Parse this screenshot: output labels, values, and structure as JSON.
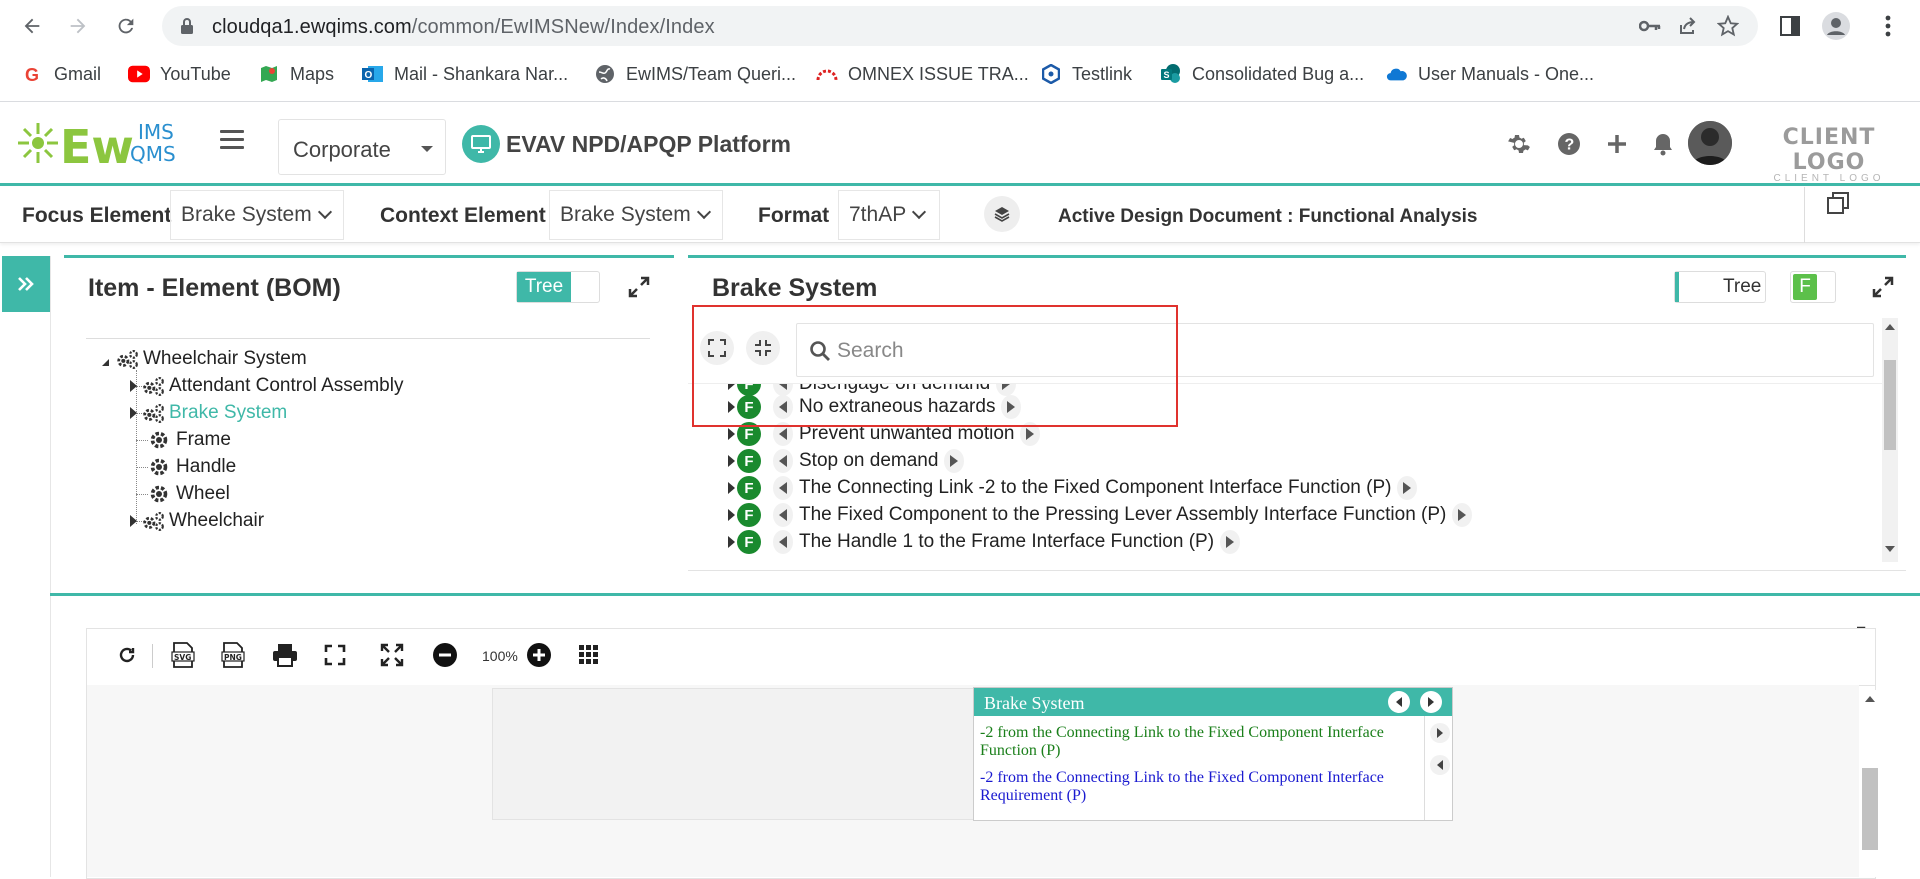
{
  "browser": {
    "url_host": "cloudqa1.ewqims.com",
    "url_path": "/common/EwIMSNew/Index/Index",
    "bookmarks": [
      {
        "label": "Gmail",
        "icon": "gmail-icon"
      },
      {
        "label": "YouTube",
        "icon": "youtube-icon"
      },
      {
        "label": "Maps",
        "icon": "maps-icon"
      },
      {
        "label": "Mail - Shankara Nar...",
        "icon": "outlook-icon"
      },
      {
        "label": "EwIMS/Team Queri...",
        "icon": "globe-icon"
      },
      {
        "label": "OMNEX ISSUE TRA...",
        "icon": "tracker-icon"
      },
      {
        "label": "Testlink",
        "icon": "testlink-icon"
      },
      {
        "label": "Consolidated Bug a...",
        "icon": "sharepoint-icon"
      },
      {
        "label": "User Manuals - One...",
        "icon": "onedrive-icon"
      }
    ]
  },
  "header": {
    "logo_text": "EwIMSQMS",
    "org_select": "Corporate",
    "platform_title": "EVAV NPD/APQP Platform",
    "client_logo": "CLIENT LOGO",
    "client_logo_sub": "CLIENT LOGO"
  },
  "focusbar": {
    "focus_label": "Focus Element",
    "focus_value": "Brake System",
    "context_label": "Context Element",
    "context_value": "Brake System",
    "format_label": "Format",
    "format_value": "7thAP",
    "active_doc": "Active Design Document : Functional Analysis"
  },
  "bom_panel": {
    "title": "Item - Element (BOM)",
    "toggle_label": "Tree",
    "tree": [
      {
        "label": "Wheelchair System",
        "level": 0,
        "expandable": true,
        "selected": false
      },
      {
        "label": "Attendant Control Assembly",
        "level": 1,
        "expandable": true,
        "selected": false
      },
      {
        "label": "Brake System",
        "level": 1,
        "expandable": true,
        "selected": true
      },
      {
        "label": "Frame",
        "level": 1,
        "expandable": false,
        "selected": false
      },
      {
        "label": "Handle",
        "level": 1,
        "expandable": false,
        "selected": false
      },
      {
        "label": "Wheel",
        "level": 1,
        "expandable": false,
        "selected": false
      },
      {
        "label": "Wheelchair",
        "level": 1,
        "expandable": true,
        "selected": false
      }
    ]
  },
  "function_panel": {
    "title": "Brake System",
    "toggle_label": "Tree",
    "f_badge": "F",
    "search_placeholder": "Search",
    "functions": [
      "Disengage on demand",
      "No extraneous hazards",
      "Prevent unwanted motion",
      "Stop on demand",
      "The Connecting Link -2 to the Fixed Component Interface Function (P)",
      "The Fixed Component to the Pressing Lever Assembly Interface Function (P)",
      "The Handle 1 to the Frame Interface Function (P)"
    ]
  },
  "diagram": {
    "zoom": "100%",
    "toolbar": [
      "refresh-icon",
      "svg-export-icon",
      "png-export-icon",
      "print-icon",
      "fit-icon",
      "fullscreen-icon",
      "zoom-out-icon",
      "zoom-in-icon",
      "grid-icon"
    ],
    "node_title": "Brake System",
    "node_lines": [
      {
        "text": "-2 from the Connecting Link to the Fixed Component Interface Function (P)",
        "color": "#1a7f1a"
      },
      {
        "text": "-2 from the Connecting Link to the Fixed Component Interface Requirement (P)",
        "color": "#1a1ad0"
      }
    ]
  },
  "colors": {
    "accent": "#3fb8a8",
    "function_badge": "#1a8a2e",
    "highlight_box": "#e0322e"
  }
}
